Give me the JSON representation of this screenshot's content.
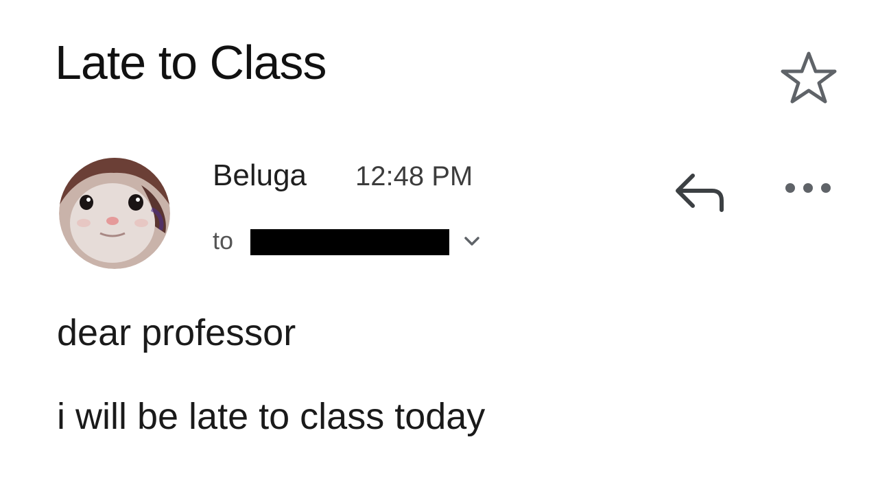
{
  "email": {
    "subject": "Late to Class",
    "sender_name": "Beluga",
    "time": "12:48 PM",
    "to_label": "to",
    "recipient": "[redacted]",
    "body_lines": [
      "dear professor",
      "i will be late to class today"
    ]
  },
  "icons": {
    "star": "star-outline-icon",
    "avatar": "cat-avatar",
    "reply": "reply-icon",
    "more": "more-horizontal-icon",
    "expand": "chevron-down-icon"
  },
  "colors": {
    "text": "#1f1f1f",
    "icon_gray": "#5f6368",
    "redaction": "#000000"
  }
}
